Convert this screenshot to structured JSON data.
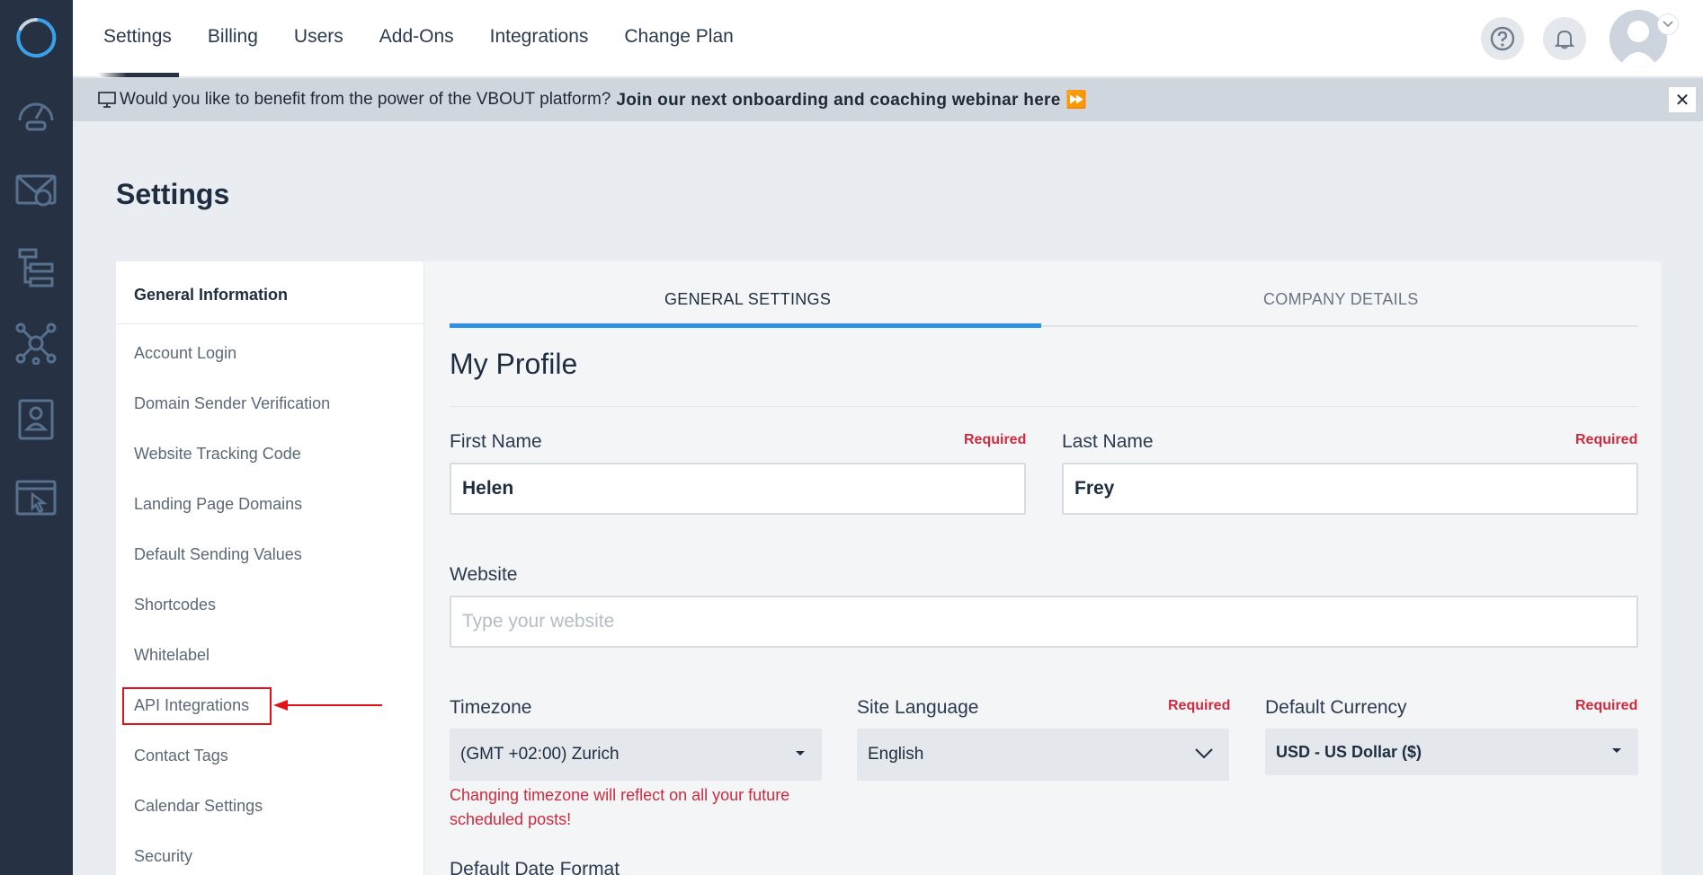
{
  "nav": {
    "tabs": [
      {
        "label": "Settings",
        "active": true
      },
      {
        "label": "Billing"
      },
      {
        "label": "Users"
      },
      {
        "label": "Add-Ons"
      },
      {
        "label": "Integrations"
      },
      {
        "label": "Change Plan"
      }
    ]
  },
  "banner": {
    "text": "Would you like to benefit from the power of the VBOUT platform?",
    "link": "Join our next onboarding and coaching webinar here ⏩",
    "close": "✕"
  },
  "page_title": "Settings",
  "sidebar": {
    "heading": "General Information",
    "items": [
      "Account Login",
      "Domain Sender Verification",
      "Website Tracking Code",
      "Landing Page Domains",
      "Default Sending Values",
      "Shortcodes",
      "Whitelabel",
      "API Integrations",
      "Contact Tags",
      "Calendar Settings",
      "Security"
    ],
    "highlighted": "API Integrations"
  },
  "tabs": {
    "general": "GENERAL SETTINGS",
    "company": "COMPANY DETAILS"
  },
  "profile": {
    "title": "My Profile",
    "first_name_label": "First Name",
    "first_name_value": "Helen",
    "last_name_label": "Last Name",
    "last_name_value": "Frey",
    "required": "Required",
    "website_label": "Website",
    "website_placeholder": "Type your website",
    "timezone_label": "Timezone",
    "timezone_value": "(GMT +02:00) Zurich",
    "timezone_warning": "Changing timezone will reflect on all your future scheduled posts!",
    "language_label": "Site Language",
    "language_value": "English",
    "currency_label": "Default Currency",
    "currency_value": "USD - US Dollar ($)",
    "next_label": "Default Date Format"
  },
  "colors": {
    "rail": "#263243",
    "accent": "#2e8fe3",
    "required": "#cf2a3e",
    "highlight": "#e0131a"
  }
}
